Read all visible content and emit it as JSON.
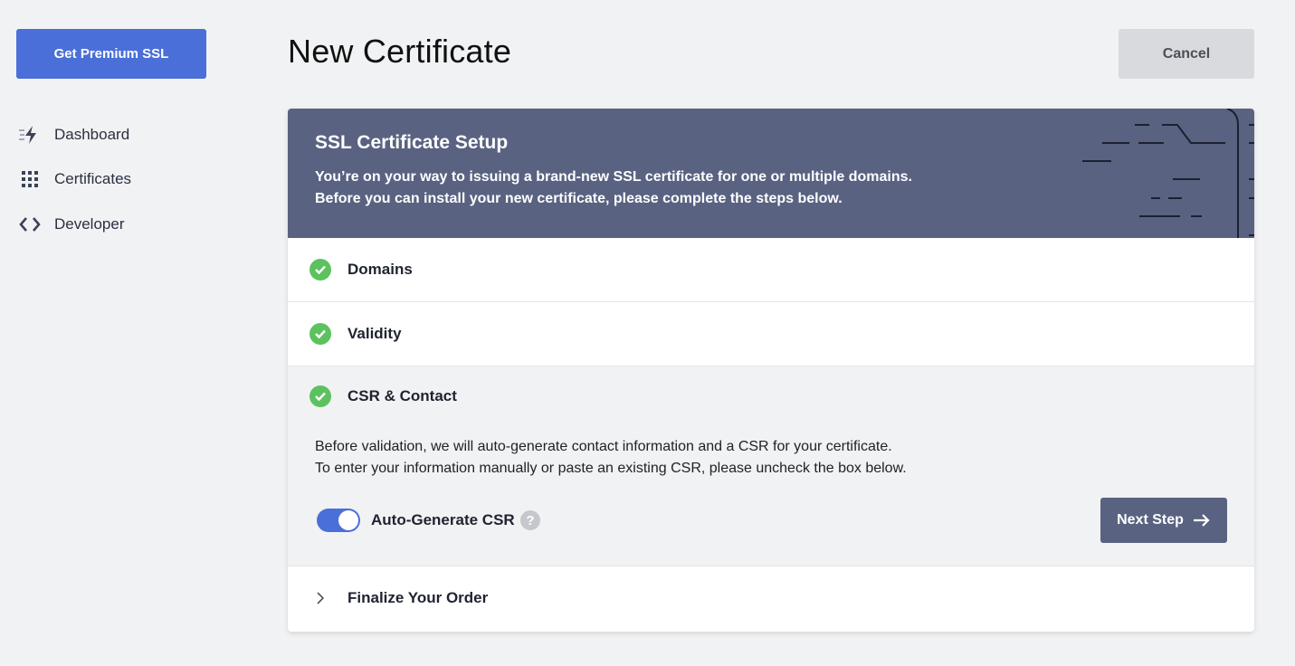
{
  "sidebar": {
    "premium_button": "Get Premium SSL",
    "items": [
      {
        "label": "Dashboard",
        "icon": "lightning-icon"
      },
      {
        "label": "Certificates",
        "icon": "grid-icon"
      },
      {
        "label": "Developer",
        "icon": "code-icon"
      }
    ]
  },
  "header": {
    "title": "New Certificate",
    "cancel_label": "Cancel"
  },
  "banner": {
    "title": "SSL Certificate Setup",
    "line1": "You’re on your way to issuing a brand-new SSL certificate for one or multiple domains.",
    "line2": "Before you can install your new certificate, please complete the steps below."
  },
  "steps": [
    {
      "label": "Domains",
      "status": "complete"
    },
    {
      "label": "Validity",
      "status": "complete"
    },
    {
      "label": "CSR & Contact",
      "status": "complete"
    },
    {
      "label": "Finalize Your Order",
      "status": "collapsed"
    }
  ],
  "csr": {
    "desc_line1": "Before validation, we will auto-generate contact information and a CSR for your certificate.",
    "desc_line2": "To enter your information manually or paste an existing CSR, please uncheck the box below.",
    "toggle_label": "Auto-Generate CSR",
    "toggle_on": true,
    "help_glyph": "?",
    "next_label": "Next Step"
  },
  "colors": {
    "accent": "#4a6fd8",
    "banner": "#596281",
    "success": "#5cc25f",
    "background": "#f1f2f4"
  }
}
